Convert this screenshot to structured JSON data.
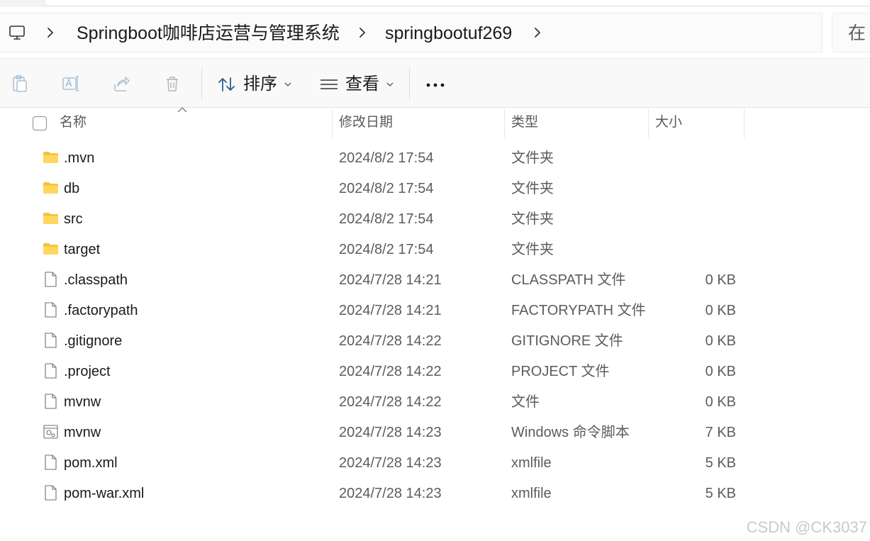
{
  "address_bar": {
    "icon": "computer-monitor-icon",
    "breadcrumbs": [
      "Springboot咖啡店运营与管理系统",
      "springbootuf269"
    ],
    "search_partial_text": "在"
  },
  "toolbar": {
    "icons": [
      "clipboard-icon",
      "rename-icon",
      "share-icon",
      "trash-icon"
    ],
    "sort_label": "排序",
    "view_label": "查看",
    "more_label": "..."
  },
  "columns": {
    "name": "名称",
    "date": "修改日期",
    "type": "类型",
    "size": "大小"
  },
  "files": [
    {
      "icon": "folder",
      "name": ".mvn",
      "date": "2024/8/2 17:54",
      "type": "文件夹",
      "size": ""
    },
    {
      "icon": "folder",
      "name": "db",
      "date": "2024/8/2 17:54",
      "type": "文件夹",
      "size": ""
    },
    {
      "icon": "folder",
      "name": "src",
      "date": "2024/8/2 17:54",
      "type": "文件夹",
      "size": ""
    },
    {
      "icon": "folder",
      "name": "target",
      "date": "2024/8/2 17:54",
      "type": "文件夹",
      "size": ""
    },
    {
      "icon": "file",
      "name": ".classpath",
      "date": "2024/7/28 14:21",
      "type": "CLASSPATH 文件",
      "size": "0 KB"
    },
    {
      "icon": "file",
      "name": ".factorypath",
      "date": "2024/7/28 14:21",
      "type": "FACTORYPATH 文件",
      "size": "0 KB"
    },
    {
      "icon": "file",
      "name": ".gitignore",
      "date": "2024/7/28 14:22",
      "type": "GITIGNORE 文件",
      "size": "0 KB"
    },
    {
      "icon": "file",
      "name": ".project",
      "date": "2024/7/28 14:22",
      "type": "PROJECT 文件",
      "size": "0 KB"
    },
    {
      "icon": "file",
      "name": "mvnw",
      "date": "2024/7/28 14:22",
      "type": "文件",
      "size": "0 KB"
    },
    {
      "icon": "script",
      "name": "mvnw",
      "date": "2024/7/28 14:23",
      "type": "Windows 命令脚本",
      "size": "7 KB"
    },
    {
      "icon": "file",
      "name": "pom.xml",
      "date": "2024/7/28 14:23",
      "type": "xmlfile",
      "size": "5 KB"
    },
    {
      "icon": "file",
      "name": "pom-war.xml",
      "date": "2024/7/28 14:23",
      "type": "xmlfile",
      "size": "5 KB"
    }
  ],
  "watermark": "CSDN @CK3037"
}
